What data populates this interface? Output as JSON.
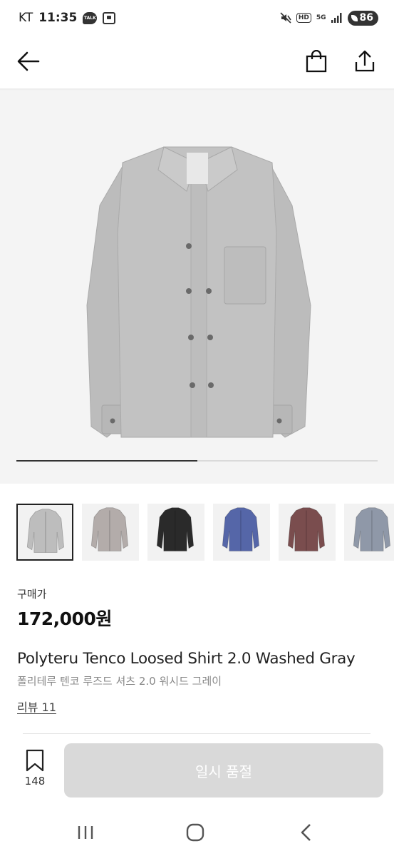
{
  "status_bar": {
    "carrier": "KT",
    "time": "11:35",
    "talk_badge": "TALK",
    "hd_label": "HD",
    "network_label": "5G",
    "battery": "86"
  },
  "header": {
    "back_icon": "arrow-left-icon",
    "bag_icon": "shopping-bag-icon",
    "share_icon": "share-icon"
  },
  "gallery": {
    "progress": 0.5,
    "colors": {
      "background": "#f4f4f4",
      "shirt": "#bdbdbd"
    }
  },
  "thumbnails": [
    {
      "color": "#bdbdbd",
      "selected": true
    },
    {
      "color": "#b3acaa",
      "selected": false
    },
    {
      "color": "#2a2a2a",
      "selected": false
    },
    {
      "color": "#5566a8",
      "selected": false
    },
    {
      "color": "#7a4d4e",
      "selected": false
    },
    {
      "color": "#8f98a8",
      "selected": false
    }
  ],
  "product": {
    "price_label": "구매가",
    "price": "172,000원",
    "name_en": "Polyteru Tenco Loosed Shirt 2.0 Washed Gray",
    "name_ko": "폴리테루 텐코 루즈드 셔츠 2.0 워시드 그레이",
    "reviews": "리뷰 11"
  },
  "action_bar": {
    "wish_icon": "bookmark-icon",
    "wish_count": "148",
    "primary_button": "일시 품절",
    "colors": {
      "button_bg": "#d9d9d9",
      "button_text": "#ffffff"
    }
  },
  "nav_bar": {
    "recent_icon": "recent-apps-icon",
    "home_icon": "home-icon",
    "back_icon": "back-chevron-icon"
  }
}
